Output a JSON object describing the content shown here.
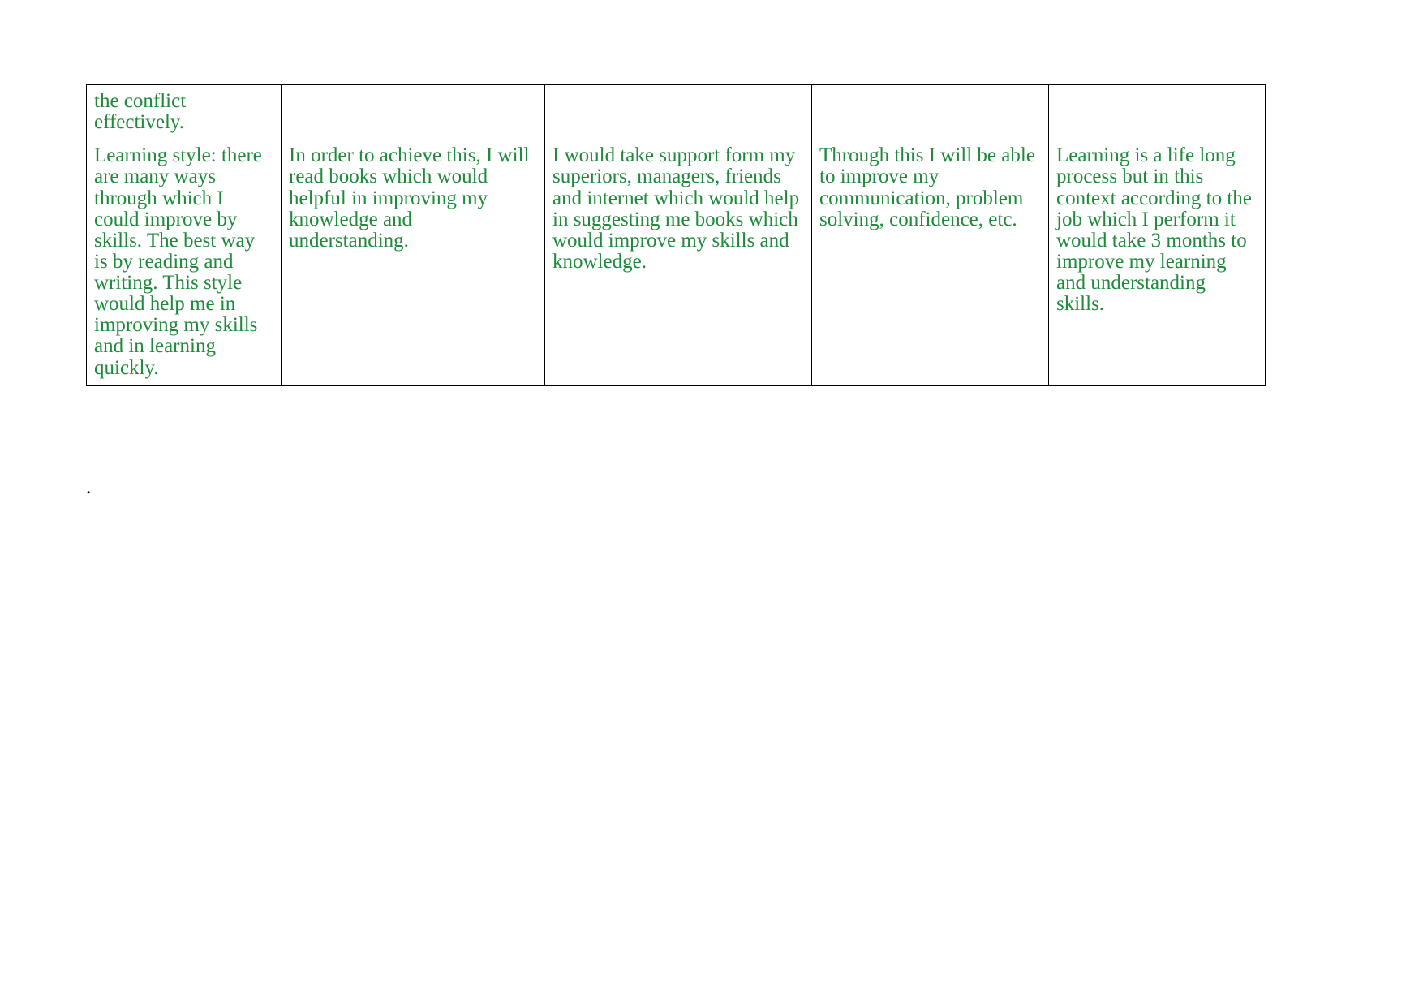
{
  "document": {
    "background_color": "#ffffff",
    "text_color": "#1F8A3C",
    "border_color": "#000000",
    "trailing_mark": "."
  },
  "table": {
    "columns": 5,
    "rows": [
      {
        "row_type": "continuation",
        "cells": [
          "the conflict\neffectively.",
          "",
          "",
          "",
          ""
        ]
      },
      {
        "row_type": "content",
        "cells": [
          "Learning style: there are many ways through which I could improve by skills. The best way is by reading and writing. This style would help me in improving my skills and in learning quickly.",
          " In order to achieve this, I will read books which would helpful in improving my knowledge and understanding.",
          "I would take support form my superiors, managers, friends and internet which would help in suggesting me books which would improve my skills and knowledge.",
          "Through this I will be able to improve my communication, problem solving, confidence, etc.",
          "Learning is a life long process but in this context according to the job which I perform it would take 3 months to improve my learning and understanding skills."
        ]
      }
    ]
  }
}
